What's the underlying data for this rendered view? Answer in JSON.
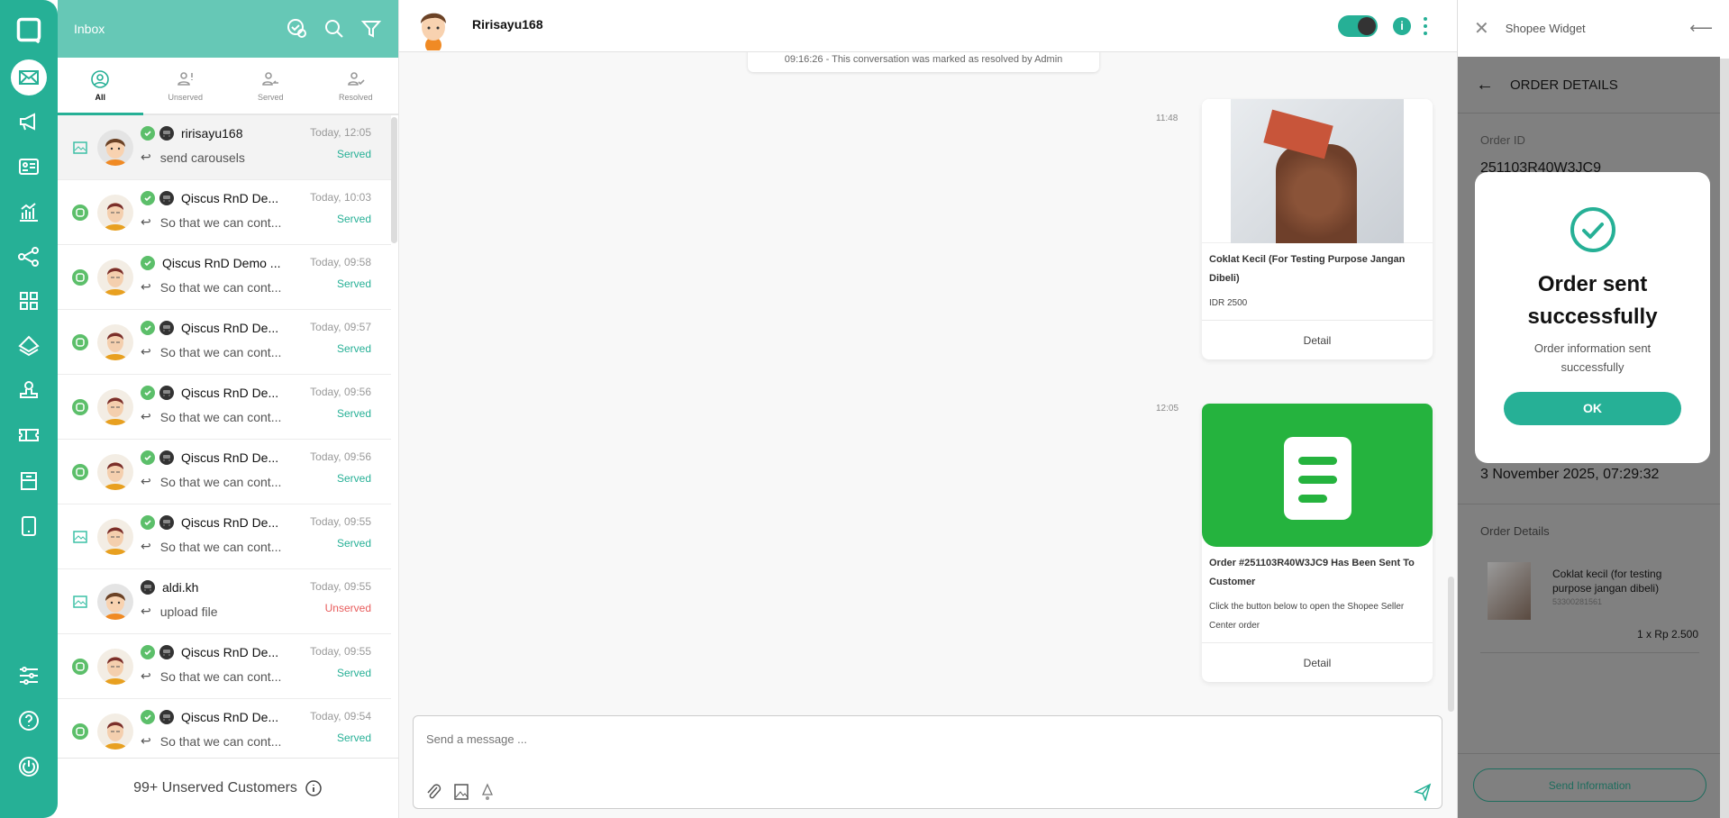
{
  "colors": {
    "brand": "#26b096",
    "header": "#66c8b6",
    "served": "#26b096",
    "unserved": "#e85c5c",
    "order_card": "#25b33e"
  },
  "rail": {
    "items": [
      "logo",
      "inbox",
      "broadcast",
      "contacts",
      "analytics",
      "integrations",
      "apps",
      "layers",
      "agents",
      "tickets",
      "storage",
      "mobile"
    ],
    "bottom": [
      "settings",
      "help",
      "logout"
    ]
  },
  "inbox": {
    "title": "Inbox",
    "tabs": [
      {
        "label": "All"
      },
      {
        "label": "Unserved"
      },
      {
        "label": "Served"
      },
      {
        "label": "Resolved"
      }
    ],
    "items": [
      {
        "name": "ririsayu168",
        "preview": "send carousels",
        "time": "Today, 12:05",
        "status": "Served",
        "channel": "image",
        "resolved": true,
        "bot": true,
        "avatar": "boy",
        "selected": true
      },
      {
        "name": "Qiscus RnD De...",
        "preview": "So that we can cont...",
        "time": "Today, 10:03",
        "status": "Served",
        "channel": "qiscus",
        "resolved": true,
        "bot": true,
        "avatar": "man"
      },
      {
        "name": "Qiscus RnD Demo ...",
        "preview": "So that we can cont...",
        "time": "Today, 09:58",
        "status": "Served",
        "channel": "qiscus",
        "resolved": true,
        "bot": false,
        "avatar": "man"
      },
      {
        "name": "Qiscus RnD De...",
        "preview": "So that we can cont...",
        "time": "Today, 09:57",
        "status": "Served",
        "channel": "qiscus",
        "resolved": true,
        "bot": true,
        "avatar": "man"
      },
      {
        "name": "Qiscus RnD De...",
        "preview": "So that we can cont...",
        "time": "Today, 09:56",
        "status": "Served",
        "channel": "qiscus",
        "resolved": true,
        "bot": true,
        "avatar": "man"
      },
      {
        "name": "Qiscus RnD De...",
        "preview": "So that we can cont...",
        "time": "Today, 09:56",
        "status": "Served",
        "channel": "qiscus",
        "resolved": true,
        "bot": true,
        "avatar": "man"
      },
      {
        "name": "Qiscus RnD De...",
        "preview": "So that we can cont...",
        "time": "Today, 09:55",
        "status": "Served",
        "channel": "image",
        "resolved": true,
        "bot": true,
        "avatar": "man"
      },
      {
        "name": "aldi.kh",
        "preview": "upload file",
        "time": "Today, 09:55",
        "status": "Unserved",
        "channel": "image",
        "resolved": false,
        "bot": true,
        "avatar": "boy"
      },
      {
        "name": "Qiscus RnD De...",
        "preview": "So that we can cont...",
        "time": "Today, 09:55",
        "status": "Served",
        "channel": "qiscus",
        "resolved": true,
        "bot": true,
        "avatar": "man"
      },
      {
        "name": "Qiscus RnD De...",
        "preview": "So that we can cont...",
        "time": "Today, 09:54",
        "status": "Served",
        "channel": "qiscus",
        "resolved": true,
        "bot": true,
        "avatar": "man"
      }
    ],
    "footer": "99+ Unserved Customers"
  },
  "chat": {
    "name": "Ririsayu168",
    "system_message": "09:16:26 - This conversation was marked as resolved by Admin",
    "messages": [
      {
        "time": "11:48",
        "title": "Coklat Kecil (For Testing Purpose Jangan Dibeli)",
        "desc": "IDR 2500",
        "button": "Detail"
      },
      {
        "time": "12:05",
        "title": "Order #251103R40W3JC9 Has Been Sent To Customer",
        "desc": "Click the button below to open the Shopee Seller Center order",
        "button": "Detail"
      }
    ],
    "composer_placeholder": "Send a message ..."
  },
  "panel": {
    "title": "Shopee Widget",
    "section_title": "ORDER DETAILS",
    "order_id_label": "Order ID",
    "order_id": "251103R40W3JC9",
    "date": "3 November 2025, 07:29:32",
    "order_details_label": "Order Details",
    "product_name": "Coklat kecil (for testing purpose jangan dibeli)",
    "product_sku": "53300281561",
    "product_price": "1 x Rp 2.500",
    "send_button": "Send Information"
  },
  "modal": {
    "title": "Order sent successfully",
    "message": "Order information sent successfully",
    "ok": "OK"
  }
}
